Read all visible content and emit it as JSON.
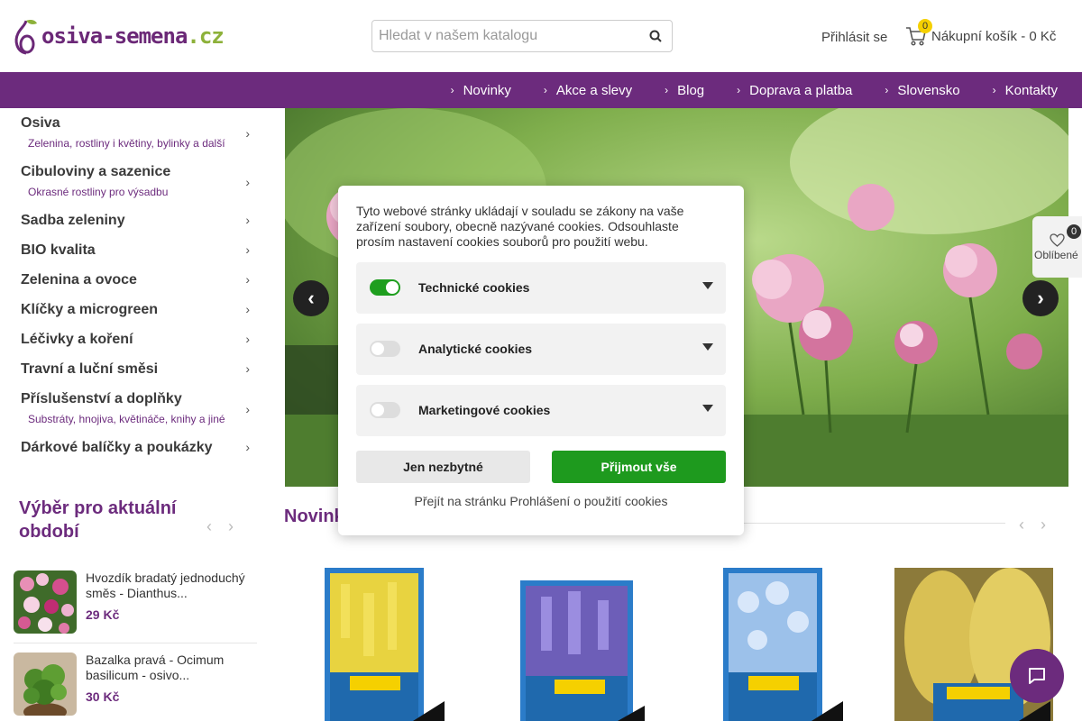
{
  "header": {
    "logo_main": "osiva-semena",
    "logo_tld": ".cz",
    "search_placeholder": "Hledat v našem katalogu",
    "login_label": "Přihlásit se",
    "cart_count": "0",
    "cart_label": "Nákupní košík - 0 Kč"
  },
  "nav": {
    "items": [
      "Novinky",
      "Akce a slevy",
      "Blog",
      "Doprava a platba",
      "Slovensko",
      "Kontakty"
    ]
  },
  "sidebar": {
    "categories": [
      {
        "title": "Osiva",
        "sub": "Zelenina, rostliny i květiny, bylinky a další"
      },
      {
        "title": "Cibuloviny a sazenice",
        "sub": "Okrasné rostliny pro výsadbu"
      },
      {
        "title": "Sadba zeleniny"
      },
      {
        "title": "BIO kvalita"
      },
      {
        "title": "Zelenina a ovoce"
      },
      {
        "title": "Klíčky a microgreen"
      },
      {
        "title": "Léčivky a koření"
      },
      {
        "title": "Travní a luční směsi"
      },
      {
        "title": "Příslušenství a doplňky",
        "sub": "Substráty, hnojiva, květináče, knihy a jiné"
      },
      {
        "title": "Dárkové balíčky a poukázky"
      }
    ],
    "season_title": "Výběr pro aktuální období",
    "products": [
      {
        "name": "Hvozdík bradatý jednoduchý směs - Dianthus...",
        "price": "29 Kč"
      },
      {
        "name": "Bazalka pravá - Ocimum basilicum - osivo...",
        "price": "30 Kč"
      }
    ]
  },
  "favorites": {
    "count": "0",
    "label": "Oblíbené"
  },
  "news": {
    "title": "Novinky"
  },
  "cookie": {
    "text": "Tyto webové stránky ukládají v souladu se zákony na vaše zařízení soubory, obecně nazývané cookies. Odsouhlaste prosím nastavení cookies souborů pro použití webu.",
    "options": [
      {
        "label": "Technické cookies",
        "enabled": true
      },
      {
        "label": "Analytické cookies",
        "enabled": false
      },
      {
        "label": "Marketingové cookies",
        "enabled": false
      }
    ],
    "btn_necessary": "Jen nezbytné",
    "btn_accept": "Přijmout vše",
    "link": "Přejít na stránku Prohlášení o použití cookies"
  },
  "colors": {
    "brand": "#6c2b7d",
    "accent_green": "#1e9a1e",
    "badge_yellow": "#f5d000"
  },
  "icons": [
    "search-icon",
    "cart-icon",
    "heart-icon",
    "chat-icon",
    "chevron-right-icon",
    "chevron-left-icon"
  ]
}
